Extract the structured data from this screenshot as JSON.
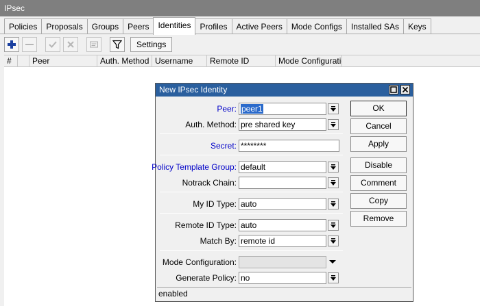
{
  "window": {
    "title": "IPsec"
  },
  "tabs": [
    {
      "label": "Policies"
    },
    {
      "label": "Proposals"
    },
    {
      "label": "Groups"
    },
    {
      "label": "Peers"
    },
    {
      "label": "Identities",
      "active": true
    },
    {
      "label": "Profiles"
    },
    {
      "label": "Active Peers"
    },
    {
      "label": "Mode Configs"
    },
    {
      "label": "Installed SAs"
    },
    {
      "label": "Keys"
    }
  ],
  "toolbar": {
    "add_icon": "plus-icon",
    "remove_icon": "minus-icon",
    "enable_icon": "check-icon",
    "disable_icon": "x-icon",
    "comment_icon": "comment-icon",
    "filter_icon": "filter-icon",
    "settings_label": "Settings"
  },
  "table": {
    "columns": [
      "#",
      "",
      "Peer",
      "Auth. Method",
      "Username",
      "Remote ID",
      "Mode Configuration"
    ]
  },
  "dialog": {
    "title": "New IPsec Identity",
    "fields": {
      "peer": {
        "label": "Peer:",
        "value": "peer1"
      },
      "auth_method": {
        "label": "Auth. Method:",
        "value": "pre shared key"
      },
      "secret": {
        "label": "Secret:",
        "value": "********"
      },
      "policy_template_group": {
        "label": "Policy Template Group:",
        "value": "default"
      },
      "notrack_chain": {
        "label": "Notrack Chain:",
        "value": ""
      },
      "my_id_type": {
        "label": "My ID Type:",
        "value": "auto"
      },
      "remote_id_type": {
        "label": "Remote ID Type:",
        "value": "auto"
      },
      "match_by": {
        "label": "Match By:",
        "value": "remote id"
      },
      "mode_configuration": {
        "label": "Mode Configuration:",
        "value": ""
      },
      "generate_policy": {
        "label": "Generate Policy:",
        "value": "no"
      }
    },
    "buttons": {
      "ok": "OK",
      "cancel": "Cancel",
      "apply": "Apply",
      "disable": "Disable",
      "comment": "Comment",
      "copy": "Copy",
      "remove": "Remove"
    },
    "status": "enabled"
  },
  "colors": {
    "titlebar": "#7f7f7f",
    "dialog_title": "#2a5f9e",
    "blue_label": "#0000c8",
    "selection": "#2a6acb",
    "add_icon": "#1a3fa0"
  }
}
